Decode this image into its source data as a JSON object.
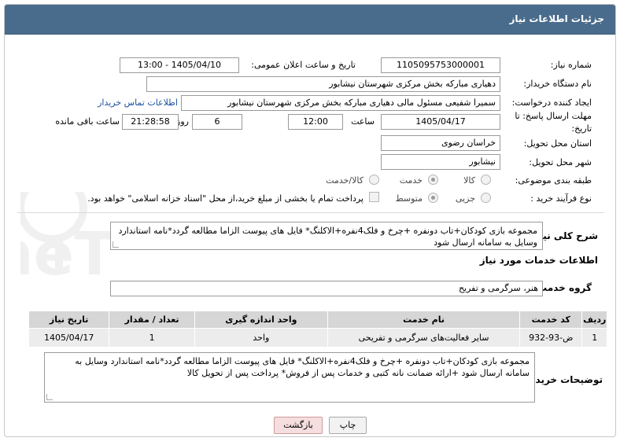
{
  "header": {
    "title": "جزئیات اطلاعات نیاز"
  },
  "form": {
    "need_number": {
      "label": "شماره نیاز:",
      "value": "1105095753000001"
    },
    "announce_datetime": {
      "label": "تاریخ و ساعت اعلان عمومی:",
      "value": "1405/04/10 - 13:00"
    },
    "buyer_org": {
      "label": "نام دستگاه خریدار:",
      "value": "دهیاری مبارکه بخش مرکزی شهرستان نیشابور"
    },
    "requester": {
      "label": "ایجاد کننده درخواست:",
      "value": "سمیرا شفیعی مسئول مالی دهیاری مبارکه بخش مرکزی شهرستان نیشابور",
      "contact_link": "اطلاعات تماس خریدار"
    },
    "deadline": {
      "label_line1": "مهلت ارسال پاسخ: تا",
      "label_line2": "تاریخ:",
      "date": "1405/04/17",
      "time_label": "ساعت",
      "time": "12:00",
      "days": "6",
      "days_label": "روز و",
      "remaining": "21:28:58",
      "remaining_label": "ساعت باقی مانده"
    },
    "province": {
      "label": "استان محل تحویل:",
      "value": "خراسان رضوی"
    },
    "city": {
      "label": "شهر محل تحویل:",
      "value": "نیشابور"
    },
    "category": {
      "label": "طبقه بندی موضوعی:",
      "options": [
        "کالا",
        "خدمت",
        "کالا/خدمت"
      ],
      "selected": "خدمت"
    },
    "purchase_type": {
      "label": "نوع فرآیند خرید :",
      "options": [
        "جزیی",
        "متوسط"
      ],
      "selected": "متوسط",
      "payment_note": "پرداخت تمام یا بخشی از مبلغ خرید،از محل \"اسناد خزانه اسلامی\" خواهد بود."
    }
  },
  "summary": {
    "label": "شرح کلی نیاز:",
    "text": "مجموعه بازی کودکان+تاب دونفره +چرخ و فلک4نفره+الاکلنگ* فایل های پیوست الزاما مطالعه گردد*نامه استاندارد وسایل به سامانه ارسال شود"
  },
  "services": {
    "section_title": "اطلاعات خدمات مورد نیاز",
    "group_label": "گروه خدمت:",
    "group_value": "هنر، سرگرمی و تفریح",
    "columns": [
      "ردیف",
      "کد خدمت",
      "نام خدمت",
      "واحد اندازه گیری",
      "تعداد / مقدار",
      "تاریخ نیاز"
    ],
    "rows": [
      [
        "1",
        "ض-93-932",
        "سایر فعالیت‌های سرگرمی و تفریحی",
        "واحد",
        "1",
        "1405/04/17"
      ]
    ]
  },
  "buyer_notes": {
    "label": "توضیحات خریدار:",
    "text": "مجموعه بازی کودکان+تاب دونفره +چرخ و فلک4نفره+الاکلنگ* فایل های پیوست الزاما مطالعه گردد*نامه استاندارد وسایل به سامانه ارسال شود +ارائه ضمانت نانه کتبی و خدمات پس از فروش* پرداخت پس از تحویل کالا"
  },
  "buttons": {
    "print": "چاپ",
    "back": "بازگشت"
  },
  "watermark": {
    "text": "AriaTender.neT"
  },
  "colors": {
    "header_bg": "#4a6c8c",
    "link": "#1a4fa0",
    "table_header": "#d6d6d6",
    "back_button": "#f6dede"
  }
}
